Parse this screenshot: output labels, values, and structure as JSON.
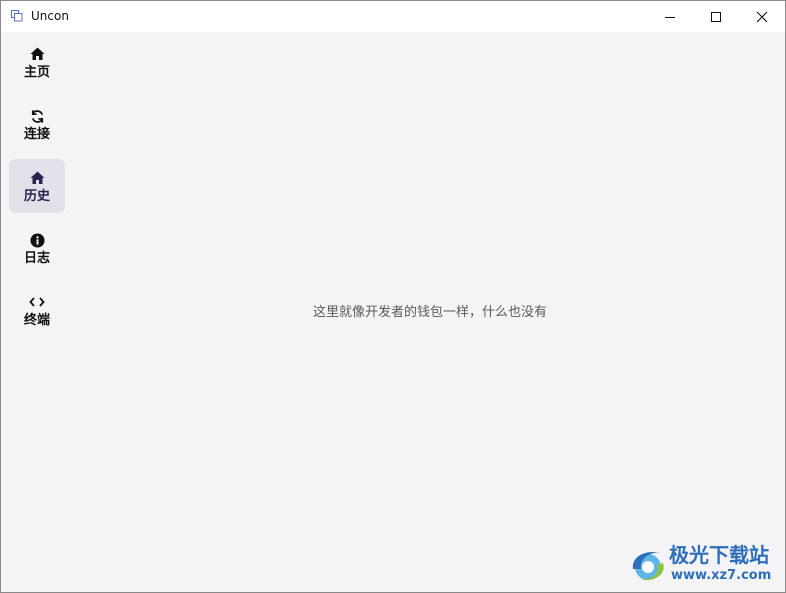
{
  "window": {
    "title": "Uncon"
  },
  "sidebar": {
    "items": [
      {
        "label": "主页",
        "icon": "home-icon"
      },
      {
        "label": "连接",
        "icon": "sync-icon"
      },
      {
        "label": "历史",
        "icon": "home-icon",
        "active": true
      },
      {
        "label": "日志",
        "icon": "info-icon"
      },
      {
        "label": "终端",
        "icon": "code-icon"
      }
    ]
  },
  "main": {
    "empty_message": "这里就像开发者的钱包一样，什么也没有"
  },
  "watermark": {
    "name": "极光下载站",
    "url": "www.xz7.com"
  },
  "colors": {
    "background": "#f4f4f6",
    "active_nav": "#e2e1ea",
    "watermark": "#2d6fb9"
  }
}
